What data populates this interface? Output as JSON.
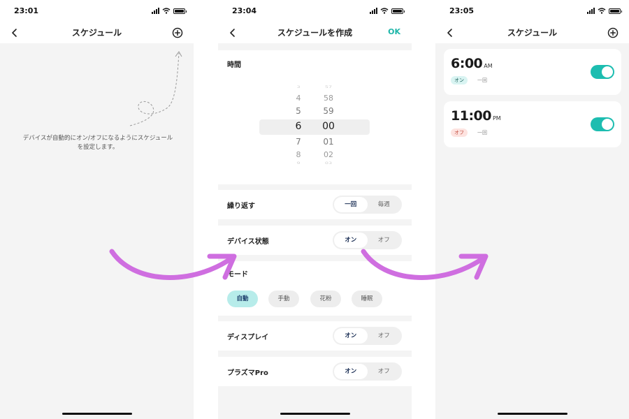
{
  "screen1": {
    "status_time": "23:01",
    "title": "スケジュール",
    "empty_message": "デバイスが自動的にオン/オフになるようにスケジュールを設定します。"
  },
  "screen2": {
    "status_time": "23:04",
    "title": "スケジュールを作成",
    "ok_label": "OK",
    "time_section_label": "時間",
    "picker": {
      "hours": [
        "3",
        "4",
        "5",
        "6",
        "7",
        "8",
        "9"
      ],
      "minutes": [
        "57",
        "58",
        "59",
        "00",
        "01",
        "02",
        "03"
      ],
      "selected_hour": "6",
      "selected_minute": "00"
    },
    "repeat": {
      "label": "繰り返す",
      "options": [
        "一回",
        "毎週"
      ],
      "selected": "一回"
    },
    "device_state": {
      "label": "デバイス状態",
      "options": [
        "オン",
        "オフ"
      ],
      "selected": "オン"
    },
    "mode": {
      "label": "モード",
      "options": [
        "自動",
        "手動",
        "花粉",
        "睡眠"
      ],
      "selected": "自動"
    },
    "display": {
      "label": "ディスプレイ",
      "options": [
        "オン",
        "オフ"
      ],
      "selected": "オン"
    },
    "plasma": {
      "label": "プラズマPro",
      "options": [
        "オン",
        "オフ"
      ],
      "selected": "オン"
    }
  },
  "screen3": {
    "status_time": "23:05",
    "title": "スケジュール",
    "schedules": [
      {
        "time": "6:00",
        "ampm": "AM",
        "state": "オン",
        "repeat": "一回",
        "enabled": true
      },
      {
        "time": "11:00",
        "ampm": "PM",
        "state": "オフ",
        "repeat": "一回",
        "enabled": true
      }
    ]
  },
  "colors": {
    "accent": "#1dbdb0",
    "ok_text": "#1fb6a9",
    "arrow": "#cf6ee0",
    "background": "#f4f4f4"
  }
}
